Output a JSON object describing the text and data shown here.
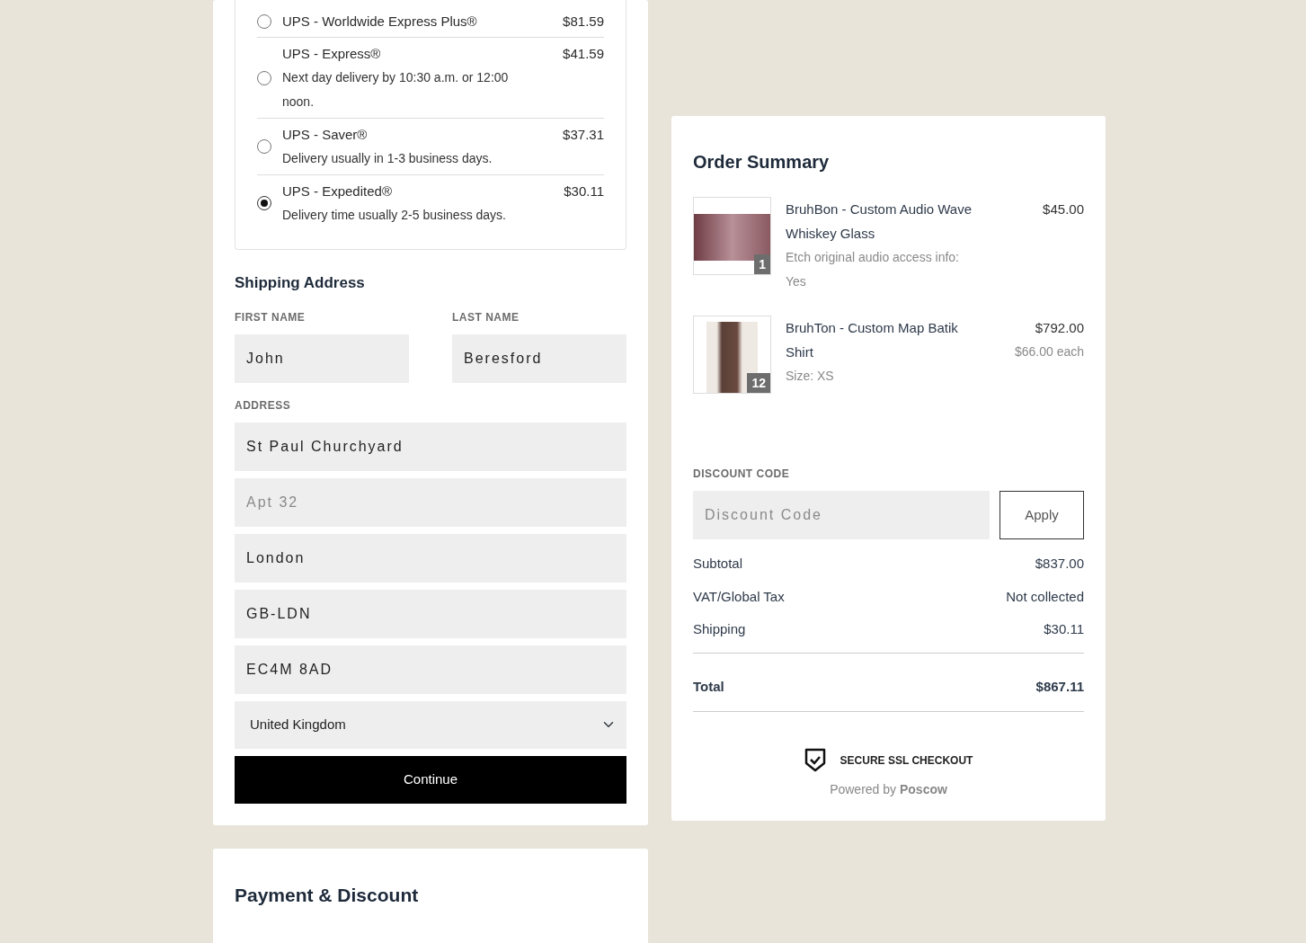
{
  "shipping_methods": [
    {
      "name": "UPS - Worldwide Express Plus®",
      "price": "$81.59",
      "selected": false
    },
    {
      "name": "UPS - Express®",
      "description": "Next day delivery by 10:30 a.m. or 12:00 noon.",
      "price": "$41.59",
      "selected": false
    },
    {
      "name": "UPS - Saver®",
      "description": "Delivery usually in 1-3 business days.",
      "price": "$37.31",
      "selected": false
    },
    {
      "name": "UPS - Expedited®",
      "description": "Delivery time usually 2-5 business days.",
      "price": "$30.11",
      "selected": true
    }
  ],
  "shipping_address": {
    "heading": "Shipping Address",
    "name_fields": [
      {
        "label": "FIRST NAME",
        "value": "John"
      },
      {
        "label": "LAST NAME",
        "value": "Beresford"
      }
    ],
    "address_label": "ADDRESS",
    "address_fields": [
      {
        "value": "St Paul Churchyard"
      },
      {
        "placeholder": "Apt 32"
      },
      {
        "value": "London"
      },
      {
        "value": "GB-LDN"
      },
      {
        "value": "EC4M 8AD"
      }
    ],
    "country": "United Kingdom",
    "continue_button": "Continue"
  },
  "payment": {
    "title": "Payment & Discount"
  },
  "order_summary": {
    "title": "Order Summary",
    "items": [
      {
        "kind": "glass",
        "name": "BruhBon - Custom Audio Wave Whiskey Glass",
        "details": [
          "Etch original audio access info: Yes"
        ],
        "price": "$45.00",
        "quantity": "1"
      },
      {
        "kind": "shirt",
        "name": "BruhTon - Custom Map Batik Shirt",
        "details": [
          "Size: XS"
        ],
        "price": "$792.00",
        "unit_price": "$66.00 each",
        "quantity": "12"
      }
    ],
    "discount": {
      "label": "DISCOUNT CODE",
      "placeholder": "Discount Code",
      "button": "Apply"
    },
    "totals": [
      {
        "kind": "line",
        "label": "Subtotal",
        "value": "$837.00"
      },
      {
        "kind": "line",
        "label": "VAT/Global Tax",
        "value": "Not collected"
      },
      {
        "kind": "line",
        "label": "Shipping",
        "value": "$30.11"
      },
      {
        "kind": "total",
        "label": "Total",
        "value": "$867.11"
      }
    ],
    "secure_text": "SECURE SSL CHECKOUT",
    "powered_by": "Powered by **Poscow**"
  }
}
